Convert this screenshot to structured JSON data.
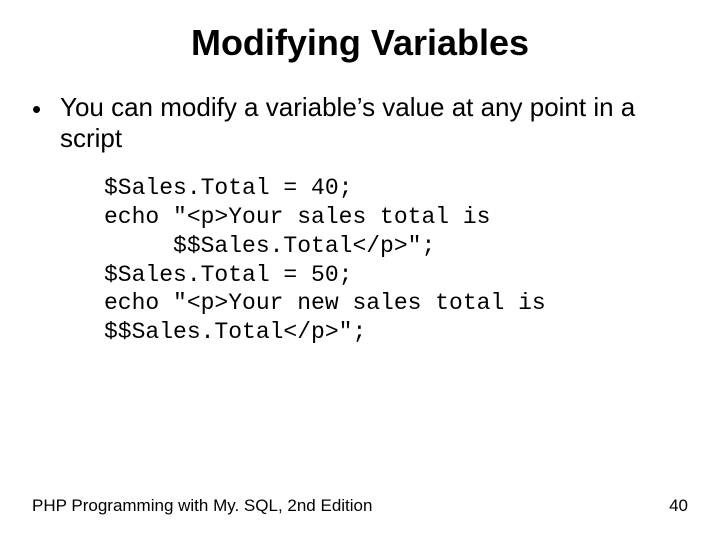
{
  "title": "Modifying Variables",
  "bullet": {
    "marker": "•",
    "text": "You can modify a variable’s value at any point in a script"
  },
  "code": "$Sales.Total = 40;\necho \"<p>Your sales total is\n     $$Sales.Total</p>\";\n$Sales.Total = 50;\necho \"<p>Your new sales total is\n$$Sales.Total</p>\";",
  "footer": {
    "left": "PHP Programming with My. SQL, 2nd Edition",
    "right": "40"
  }
}
